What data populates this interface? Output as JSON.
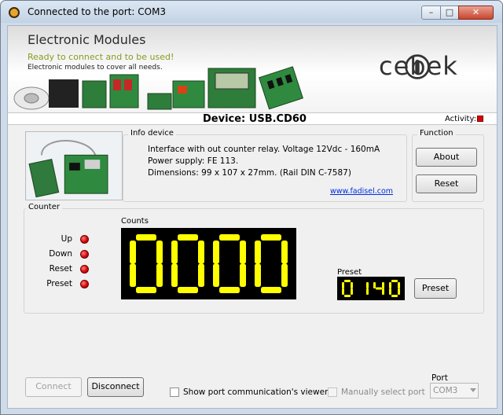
{
  "window": {
    "title": "Connected to the port: COM3",
    "controls": {
      "minimize": "–",
      "maximize": "□",
      "close": "✕"
    }
  },
  "banner": {
    "title": "Electronic Modules",
    "subtitle": "Ready to connect and to be used!",
    "description": "Electronic modules to cover all needs.",
    "brand": "cebek"
  },
  "device_bar": {
    "device_label": "Device: USB.CD60",
    "activity_label": "Activity:",
    "activity_color": "#e00000"
  },
  "info_device": {
    "legend": "Info device",
    "line1": "Interface with out counter relay.   Voltage 12Vdc - 160mA",
    "line2": "Power supply: FE 113.",
    "line3": "Dimensions: 99 x 107 x 27mm. (Rail DIN C-7587)",
    "link": "www.fadisel.com"
  },
  "function": {
    "legend": "Function",
    "about_label": "About",
    "reset_label": "Reset"
  },
  "counter": {
    "legend": "Counter",
    "counts_label": "Counts",
    "counts_value": "0000",
    "leds": [
      {
        "label": "Up"
      },
      {
        "label": "Down"
      },
      {
        "label": "Reset"
      },
      {
        "label": "Preset"
      }
    ],
    "preset_label": "Preset",
    "preset_value": "0140",
    "preset_button": "Preset",
    "display_color": "#ffff00"
  },
  "footer": {
    "connect_label": "Connect",
    "disconnect_label": "Disconnect",
    "show_viewer_label": "Show port communication's viewer",
    "manual_port_label": "Manually select port",
    "port_label": "Port",
    "port_value": "COM3"
  }
}
